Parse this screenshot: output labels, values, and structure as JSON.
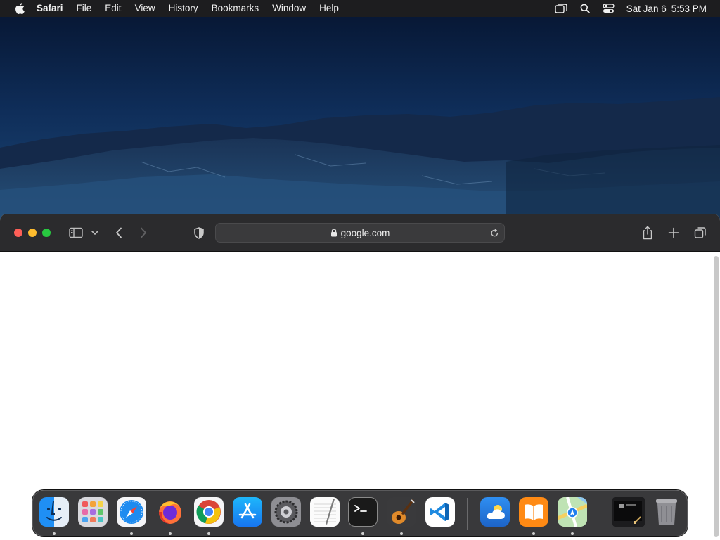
{
  "menubar": {
    "app_name": "Safari",
    "items": [
      "File",
      "Edit",
      "View",
      "History",
      "Bookmarks",
      "Window",
      "Help"
    ],
    "status_icons": [
      "screen-mirroring-icon",
      "spotlight-search-icon",
      "control-center-icon"
    ],
    "date": "Sat Jan 6",
    "time": "5:53 PM"
  },
  "safari": {
    "address": "google.com",
    "toolbar_icons": [
      "sidebar-icon",
      "tab-group-chevron-icon",
      "back-icon",
      "forward-icon",
      "privacy-shield-icon",
      "share-icon",
      "new-tab-icon",
      "tab-overview-icon"
    ]
  },
  "dock": {
    "apps": [
      {
        "name": "Finder",
        "running": true
      },
      {
        "name": "Launchpad",
        "running": false
      },
      {
        "name": "Safari",
        "running": true
      },
      {
        "name": "Firefox",
        "running": true
      },
      {
        "name": "Google Chrome",
        "running": true
      },
      {
        "name": "App Store",
        "running": false
      },
      {
        "name": "System Settings",
        "running": false
      },
      {
        "name": "TextEdit",
        "running": false
      },
      {
        "name": "Terminal",
        "running": true
      },
      {
        "name": "GarageBand",
        "running": true
      },
      {
        "name": "Visual Studio Code",
        "running": false
      },
      {
        "name": "Weather",
        "running": false
      },
      {
        "name": "Books",
        "running": true
      },
      {
        "name": "Maps",
        "running": true
      },
      {
        "name": "Screenshot Folder",
        "running": false
      },
      {
        "name": "Trash",
        "running": false
      }
    ]
  },
  "colors": {
    "menubar_bg": "#1d1d1f",
    "toolbar_bg": "#2b2b2d",
    "close": "#fe5f57",
    "minimize": "#febc2e",
    "zoom": "#28c840"
  }
}
